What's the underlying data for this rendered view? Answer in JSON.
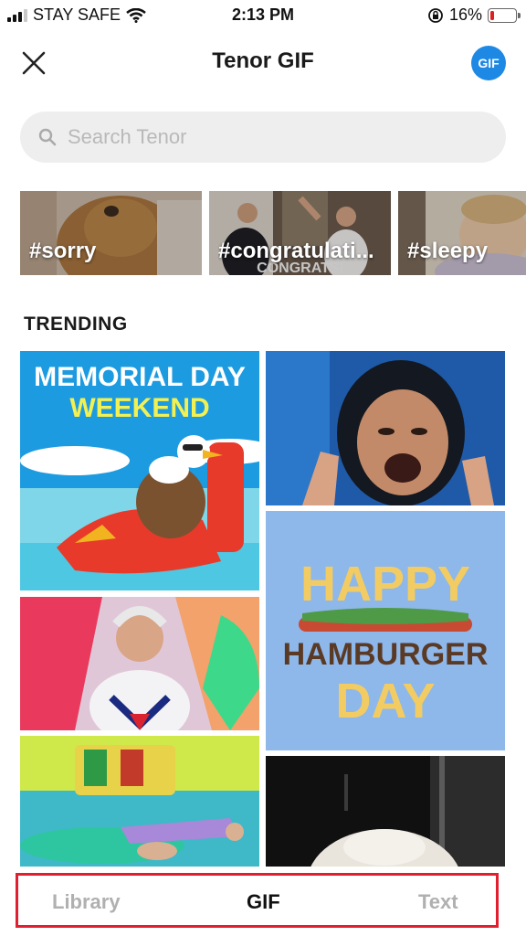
{
  "status_bar": {
    "carrier": "STAY SAFE",
    "time": "2:13 PM",
    "battery": "16%",
    "battery_level": 0.16
  },
  "header": {
    "title": "Tenor GIF",
    "badge": "GIF"
  },
  "search": {
    "placeholder": "Search Tenor"
  },
  "categories": [
    {
      "tag": "#sorry"
    },
    {
      "tag": "#congratulati..."
    },
    {
      "tag": "#sleepy"
    }
  ],
  "gifs": {
    "memorial": {
      "line1": "MEMORIAL DAY",
      "line2": "WEEKEND"
    },
    "hamburger": {
      "line1": "HAPPY",
      "line2": "HAMBURGER",
      "line3": "DAY"
    },
    "congrats_caption": "CONGRATS!"
  },
  "section": {
    "trending": "TRENDING"
  },
  "tabs": [
    {
      "label": "Library"
    },
    {
      "label": "GIF"
    },
    {
      "label": "Text"
    }
  ],
  "colors": {
    "accent": "#1e88e5",
    "highlight_outline": "#e02030",
    "battery_low": "#e02020"
  }
}
